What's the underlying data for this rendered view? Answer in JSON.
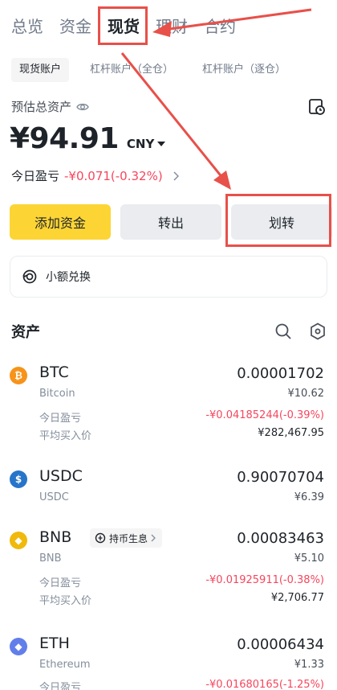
{
  "top_tabs": [
    {
      "label": "总览"
    },
    {
      "label": "资金"
    },
    {
      "label": "现货"
    },
    {
      "label": "理财"
    },
    {
      "label": "合约"
    }
  ],
  "sub_tabs": [
    {
      "label": "现货账户"
    },
    {
      "label": "杠杆账户（全仓）"
    },
    {
      "label": "杠杆账户（逐仓）"
    }
  ],
  "balance": {
    "label": "预估总资产",
    "value": "¥94.91",
    "currency": "CNY",
    "pnl_label": "今日盈亏",
    "pnl_value": "-¥0.071(-0.32%)"
  },
  "actions": {
    "deposit": "添加资金",
    "withdraw": "转出",
    "transfer": "划转"
  },
  "convert": {
    "label": "小额兑换"
  },
  "assets": {
    "title": "资产",
    "items": [
      {
        "symbol": "BTC",
        "name": "Bitcoin",
        "amount": "0.00001702",
        "fiat": "¥10.62",
        "pnl_label": "今日盈亏",
        "pnl_value": "-¥0.04185244(-0.39%)",
        "avg_label": "平均买入价",
        "avg_value": "¥282,467.95",
        "color": "#f7931a",
        "icon": "bitcoin-icon",
        "glyph": "₿"
      },
      {
        "symbol": "USDC",
        "name": "USDC",
        "amount": "0.90070704",
        "fiat": "¥6.39",
        "color": "#2775ca",
        "icon": "usdc-icon",
        "glyph": "$"
      },
      {
        "symbol": "BNB",
        "name": "BNB",
        "amount": "0.00083463",
        "fiat": "¥5.10",
        "earn_tag": "持币生息",
        "pnl_label": "今日盈亏",
        "pnl_value": "-¥0.01925911(-0.38%)",
        "avg_label": "平均买入价",
        "avg_value": "¥2,706.77",
        "color": "#f0b90b",
        "icon": "bnb-icon",
        "glyph": "◆"
      },
      {
        "symbol": "ETH",
        "name": "Ethereum",
        "amount": "0.00006434",
        "fiat": "¥1.33",
        "pnl_label": "今日盈亏",
        "pnl_value": "-¥0.01680165(-1.25%)",
        "color": "#627eea",
        "icon": "ethereum-icon",
        "glyph": "◆"
      }
    ]
  },
  "colors": {
    "accent": "#fcd535",
    "negative": "#f6465d",
    "annotation": "#e8504a"
  }
}
